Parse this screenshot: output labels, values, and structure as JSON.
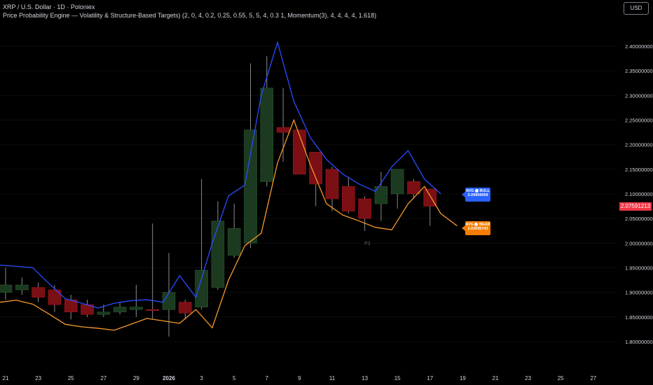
{
  "header": {
    "title": "XRP / U.S. Dollar · 1D · Poloniex",
    "indicator": "Price Probability Engine — Volatility & Structure-Based Targets) (2, 0, 4, 0.2, 0.25, 0.55, 5, 5, 4, 0.3 1, Momentum(3), 4, 4, 4, 4, 1.618)"
  },
  "toolbar": {
    "currency": "USD"
  },
  "labels": {
    "bull_title": "AVG",
    "bull_name": "BULL",
    "bull_value": "2.09969058",
    "bear_title": "AVG",
    "bear_name": "BEAR",
    "bear_value": "2.03095743",
    "current_price": "2.07591213",
    "pivot_marker": "P3"
  },
  "colors": {
    "up_body": "#1b3a1f",
    "down_body": "#7a0f14",
    "bull_line": "#2a4cff",
    "bear_line": "#f59a2a",
    "wick": "#8a8a8a",
    "price_tag": "#f23645"
  },
  "chart_data": {
    "type": "candlestick",
    "ylim": [
      1.78,
      2.42
    ],
    "yticks": [
      "2.40000000",
      "2.35000000",
      "2.30000000",
      "2.25000000",
      "2.20000000",
      "2.15000000",
      "2.10000000",
      "2.05000000",
      "2.00000000",
      "1.95000000",
      "1.90000000",
      "1.85000000",
      "1.80000000"
    ],
    "xticks": [
      {
        "label": "21",
        "i": 0
      },
      {
        "label": "23",
        "i": 2
      },
      {
        "label": "25",
        "i": 4
      },
      {
        "label": "27",
        "i": 6
      },
      {
        "label": "29",
        "i": 8
      },
      {
        "label": "2026",
        "i": 10
      },
      {
        "label": "3",
        "i": 12
      },
      {
        "label": "5",
        "i": 14
      },
      {
        "label": "7",
        "i": 16
      },
      {
        "label": "9",
        "i": 18
      },
      {
        "label": "11",
        "i": 20
      },
      {
        "label": "13",
        "i": 22
      },
      {
        "label": "15",
        "i": 24
      },
      {
        "label": "17",
        "i": 26
      },
      {
        "label": "19",
        "i": 28
      },
      {
        "label": "21",
        "i": 30
      },
      {
        "label": "23",
        "i": 32
      },
      {
        "label": "25",
        "i": 34
      },
      {
        "label": "27",
        "i": 36
      }
    ],
    "candles": [
      {
        "o": 1.9,
        "h": 1.95,
        "l": 1.885,
        "c": 1.915
      },
      {
        "o": 1.905,
        "h": 1.93,
        "l": 1.895,
        "c": 1.915
      },
      {
        "o": 1.91,
        "h": 1.92,
        "l": 1.88,
        "c": 1.89
      },
      {
        "o": 1.905,
        "h": 1.915,
        "l": 1.86,
        "c": 1.875
      },
      {
        "o": 1.885,
        "h": 1.895,
        "l": 1.845,
        "c": 1.86
      },
      {
        "o": 1.875,
        "h": 1.885,
        "l": 1.85,
        "c": 1.855
      },
      {
        "o": 1.855,
        "h": 1.875,
        "l": 1.85,
        "c": 1.86
      },
      {
        "o": 1.86,
        "h": 1.88,
        "l": 1.855,
        "c": 1.87
      },
      {
        "o": 1.865,
        "h": 1.915,
        "l": 1.85,
        "c": 1.87
      },
      {
        "o": 1.865,
        "h": 2.04,
        "l": 1.845,
        "c": 1.863
      },
      {
        "o": 1.865,
        "h": 1.98,
        "l": 1.81,
        "c": 1.9
      },
      {
        "o": 1.88,
        "h": 1.885,
        "l": 1.845,
        "c": 1.858
      },
      {
        "o": 1.87,
        "h": 2.13,
        "l": 1.865,
        "c": 1.945
      },
      {
        "o": 1.91,
        "h": 2.085,
        "l": 1.905,
        "c": 2.045
      },
      {
        "o": 1.975,
        "h": 2.08,
        "l": 1.97,
        "c": 2.03
      },
      {
        "o": 2.0,
        "h": 2.365,
        "l": 1.99,
        "c": 2.23
      },
      {
        "o": 2.125,
        "h": 2.38,
        "l": 2.115,
        "c": 2.315
      },
      {
        "o": 2.235,
        "h": 2.315,
        "l": 2.165,
        "c": 2.225
      },
      {
        "o": 2.23,
        "h": 2.23,
        "l": 2.14,
        "c": 2.14
      },
      {
        "o": 2.185,
        "h": 2.185,
        "l": 2.075,
        "c": 2.12
      },
      {
        "o": 2.15,
        "h": 2.155,
        "l": 2.065,
        "c": 2.09
      },
      {
        "o": 2.115,
        "h": 2.135,
        "l": 2.06,
        "c": 2.065
      },
      {
        "o": 2.09,
        "h": 2.095,
        "l": 2.025,
        "c": 2.05
      },
      {
        "o": 2.08,
        "h": 2.145,
        "l": 2.045,
        "c": 2.115
      },
      {
        "o": 2.1,
        "h": 2.15,
        "l": 2.07,
        "c": 2.15
      },
      {
        "o": 2.125,
        "h": 2.13,
        "l": 2.09,
        "c": 2.1
      },
      {
        "o": 2.11,
        "h": 2.11,
        "l": 2.035,
        "c": 2.075
      }
    ],
    "series": [
      {
        "name": "AVG BULL",
        "values": [
          1.955,
          1.953,
          1.95,
          1.918,
          1.887,
          1.878,
          1.868,
          1.878,
          1.883,
          1.885,
          1.88,
          1.934,
          1.89,
          2.0,
          2.096,
          2.118,
          2.3,
          2.408,
          2.288,
          2.215,
          2.17,
          2.14,
          2.12,
          2.105,
          2.155,
          2.188,
          2.13,
          2.1
        ]
      },
      {
        "name": "AVG BEAR",
        "values": [
          1.88,
          1.884,
          1.876,
          1.856,
          1.835,
          1.83,
          1.827,
          1.823,
          1.835,
          1.847,
          1.842,
          1.837,
          1.865,
          1.828,
          1.925,
          1.995,
          2.02,
          2.163,
          2.25,
          2.16,
          2.08,
          2.057,
          2.045,
          2.032,
          2.027,
          2.08,
          2.115,
          2.06,
          2.035
        ]
      }
    ]
  }
}
